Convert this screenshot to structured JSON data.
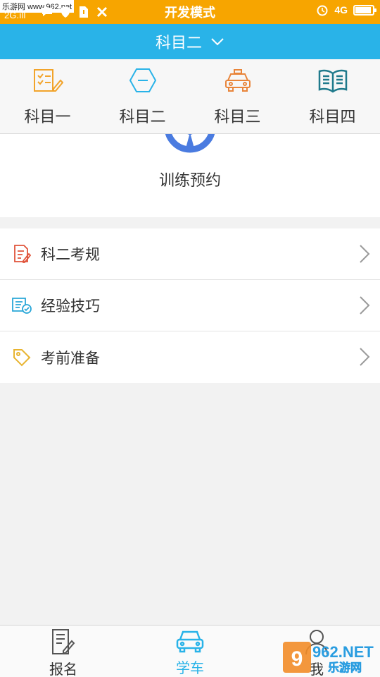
{
  "statusbar": {
    "watermark": "乐游网 www.962.net",
    "signal": "2G.ıll",
    "title": "开发模式",
    "network": "4G",
    "battery_level": 0.92
  },
  "header": {
    "title": "科目二"
  },
  "subjects": [
    {
      "label": "科目一",
      "icon": "checklist-pen-icon",
      "color": "#f2a42b"
    },
    {
      "label": "科目二",
      "icon": "hexagon-minus-icon",
      "color": "#29b3e8"
    },
    {
      "label": "科目三",
      "icon": "taxi-icon",
      "color": "#e9853a"
    },
    {
      "label": "科目四",
      "icon": "open-book-icon",
      "color": "#1f7a8c"
    }
  ],
  "training": {
    "label": "训练预约",
    "icon": "steering-wheel-icon",
    "color": "#4a7be0"
  },
  "list": [
    {
      "label": "科二考规",
      "icon": "document-pen-icon",
      "color": "#e0533a"
    },
    {
      "label": "经验技巧",
      "icon": "document-check-icon",
      "color": "#2aa7d8"
    },
    {
      "label": "考前准备",
      "icon": "tag-icon",
      "color": "#e8b430"
    }
  ],
  "bottomnav": [
    {
      "label": "报名",
      "icon": "form-pen-icon",
      "active": false
    },
    {
      "label": "学车",
      "icon": "car-icon",
      "active": true
    },
    {
      "label": "我",
      "icon": "person-icon",
      "active": false
    }
  ],
  "logo": {
    "text_top": "962.NET",
    "text_bottom": "乐游网"
  },
  "colors": {
    "status": "#f7a500",
    "accent": "#29b3e8"
  }
}
